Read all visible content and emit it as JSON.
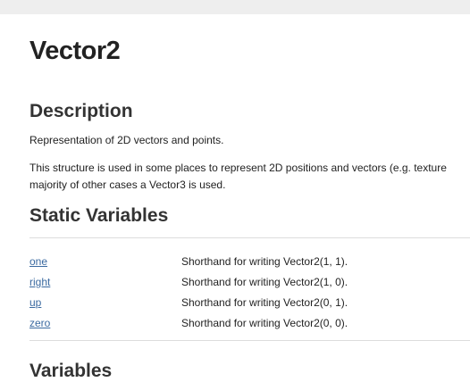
{
  "page": {
    "title": "Vector2"
  },
  "description": {
    "heading": "Description",
    "para1": "Representation of 2D vectors and points.",
    "para2_line1": "This structure is used in some places to represent 2D positions and vectors (e.g. texture",
    "para2_line2": "majority of other cases a Vector3 is used."
  },
  "static_variables": {
    "heading": "Static Variables",
    "rows": [
      {
        "name": "one",
        "desc": "Shorthand for writing Vector2(1, 1)."
      },
      {
        "name": "right",
        "desc": "Shorthand for writing Vector2(1, 0)."
      },
      {
        "name": "up",
        "desc": "Shorthand for writing Vector2(0, 1)."
      },
      {
        "name": "zero",
        "desc": "Shorthand for writing Vector2(0, 0)."
      }
    ]
  },
  "variables": {
    "heading": "Variables"
  }
}
